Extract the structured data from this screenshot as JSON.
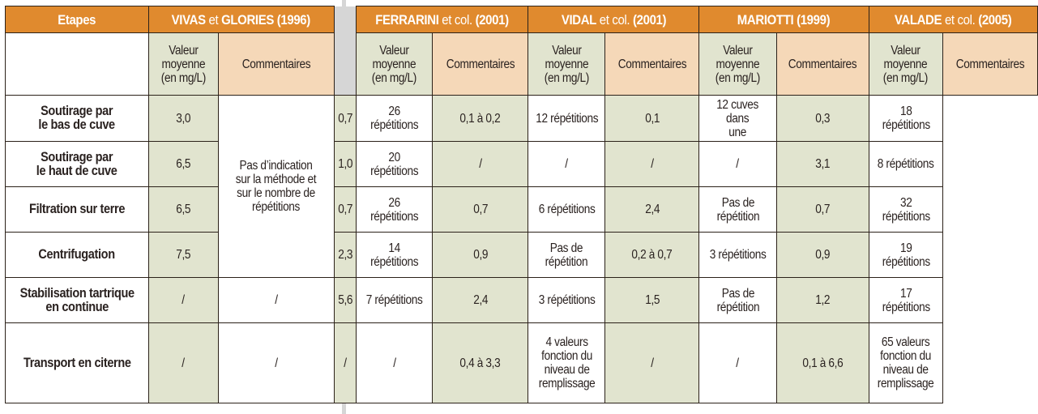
{
  "table": {
    "corner_label": "Etapes",
    "studies": [
      {
        "name": "VIVAS",
        "suffix": " et ",
        "rest": "GLORIES (1996)"
      },
      {
        "name": "FERRARINI",
        "suffix": " et col. ",
        "rest": "(2001)"
      },
      {
        "name": "VIDAL",
        "suffix": " et col. ",
        "rest": "(2001)"
      },
      {
        "name": "MARIOTTI",
        "suffix": " ",
        "rest": "(1999)"
      },
      {
        "name": "VALADE",
        "suffix": " et col. ",
        "rest": "(2005)"
      }
    ],
    "subheaders": {
      "value_lines": [
        "Valeur",
        "moyenne",
        "(en mg/L)"
      ],
      "comment": "Commentaires"
    },
    "vivas_merged_comment_lines": [
      "Pas d’indication",
      "sur la méthode et",
      "sur le nombre de",
      "répétitions"
    ],
    "rows": [
      {
        "etape_lines": [
          "Soutirage par",
          "le bas de cuve"
        ],
        "vivas_value": "3,0",
        "ferrarini": {
          "value": "0,7",
          "comment_lines": [
            "26 répétitions"
          ]
        },
        "vidal": {
          "value": "0,1 à 0,2",
          "comment_lines": [
            "12 répétitions"
          ]
        },
        "mariotti": {
          "value": "0,1",
          "comment_lines": [
            "12 cuves dans",
            "une"
          ]
        },
        "valade": {
          "value": "0,3",
          "comment_lines": [
            "18 répétitions"
          ]
        }
      },
      {
        "etape_lines": [
          "Soutirage par",
          "le haut de cuve"
        ],
        "vivas_value": "6,5",
        "ferrarini": {
          "value": "1,0",
          "comment_lines": [
            "20 répétitions"
          ]
        },
        "vidal": {
          "value": "/",
          "comment_lines": [
            "/"
          ]
        },
        "mariotti": {
          "value": "/",
          "comment_lines": [
            "/"
          ]
        },
        "valade": {
          "value": "3,1",
          "comment_lines": [
            "8 répétitions"
          ]
        }
      },
      {
        "etape_lines": [
          "Filtration sur terre"
        ],
        "vivas_value": "6,5",
        "ferrarini": {
          "value": "0,7",
          "comment_lines": [
            "26 répétitions"
          ]
        },
        "vidal": {
          "value": "0,7",
          "comment_lines": [
            "6 répétitions"
          ]
        },
        "mariotti": {
          "value": "2,4",
          "comment_lines": [
            "Pas de",
            "répétition"
          ]
        },
        "valade": {
          "value": "0,7",
          "comment_lines": [
            "32 répétitions"
          ]
        }
      },
      {
        "etape_lines": [
          "Centrifugation"
        ],
        "vivas_value": "7,5",
        "ferrarini": {
          "value": "2,3",
          "comment_lines": [
            "14 répétitions"
          ]
        },
        "vidal": {
          "value": "0,9",
          "comment_lines": [
            "Pas de",
            "répétition"
          ]
        },
        "mariotti": {
          "value": "0,2 à 0,7",
          "comment_lines": [
            "3 répétitions"
          ]
        },
        "valade": {
          "value": "0,9",
          "comment_lines": [
            "19 répétitions"
          ]
        }
      },
      {
        "etape_lines": [
          "Stabilisation tartrique",
          "en continue"
        ],
        "vivas_value": "/",
        "vivas_comment": "/",
        "ferrarini": {
          "value": "5,6",
          "comment_lines": [
            "7 répétitions"
          ]
        },
        "vidal": {
          "value": "2,4",
          "comment_lines": [
            "3 répétitions"
          ]
        },
        "mariotti": {
          "value": "1,5",
          "comment_lines": [
            "Pas de",
            "répétition"
          ]
        },
        "valade": {
          "value": "1,2",
          "comment_lines": [
            "17 répétitions"
          ]
        }
      },
      {
        "etape_lines": [
          "Transport en citerne"
        ],
        "vivas_value": "/",
        "vivas_comment": "/",
        "ferrarini": {
          "value": "/",
          "comment_lines": [
            "/"
          ]
        },
        "vidal": {
          "value": "0,4 à 3,3",
          "comment_lines": [
            "4 valeurs",
            "fonction du",
            "niveau de",
            "remplissage"
          ]
        },
        "mariotti": {
          "value": "/",
          "comment_lines": [
            "/"
          ]
        },
        "valade": {
          "value": "0,1 à 6,6",
          "comment_lines": [
            "65 valeurs",
            "fonction du",
            "niveau de",
            "remplissage"
          ]
        }
      }
    ]
  }
}
